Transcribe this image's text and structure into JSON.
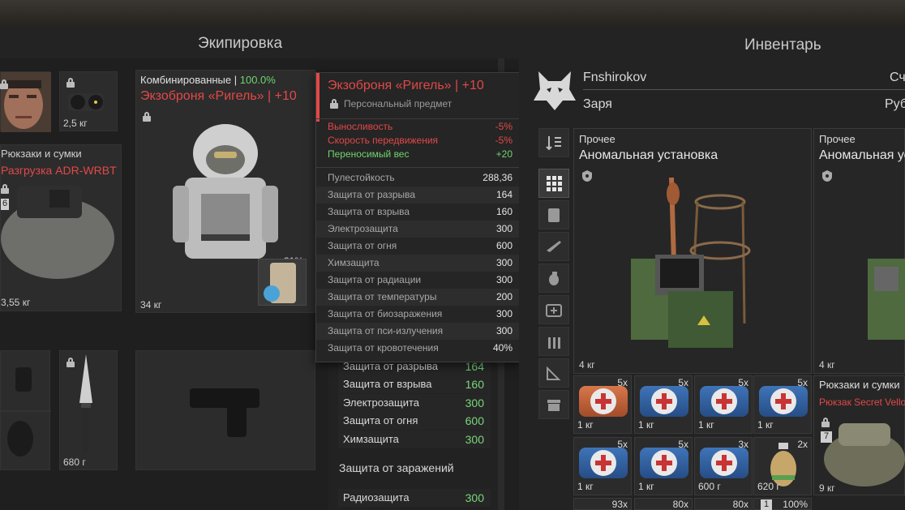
{
  "header": {
    "equipment_title": "Экипировка",
    "inventory_title": "Инвентарь"
  },
  "equipment": {
    "slot_helmet_weight": "2,5 кг",
    "backpack": {
      "category": "Рюкзаки и сумки",
      "name": "Разгрузка ADR-WRBT",
      "badge": "6",
      "weight": "3,55 кг"
    },
    "armor": {
      "category": "Комбинированные",
      "percent": "100.0%",
      "name": "Экзоброня «Ригель» | +10",
      "weight": "34 кг",
      "container_percent": "31%"
    },
    "knife_weight": "680 г"
  },
  "tooltip": {
    "title": "Экзоброня «Ригель» | +10",
    "subtitle": "Персональный предмет",
    "effects": [
      {
        "label": "Выносливость",
        "value": "-5%",
        "color": "#e24848"
      },
      {
        "label": "Скорость передвижения",
        "value": "-5%",
        "color": "#e24848"
      },
      {
        "label": "Переносимый вес",
        "value": "+20",
        "color": "#6fd46f"
      }
    ],
    "stats": [
      {
        "label": "Пулестойкость",
        "value": "288,36"
      },
      {
        "label": "Защита от разрыва",
        "value": "164"
      },
      {
        "label": "Защита от взрыва",
        "value": "160"
      },
      {
        "label": "Электрозащита",
        "value": "300"
      },
      {
        "label": "Защита от огня",
        "value": "600"
      },
      {
        "label": "Химзащита",
        "value": "300"
      },
      {
        "label": "Защита от радиации",
        "value": "300"
      },
      {
        "label": "Защита от температуры",
        "value": "200"
      },
      {
        "label": "Защита от биозаражения",
        "value": "300"
      },
      {
        "label": "Защита от пси-излучения",
        "value": "300"
      },
      {
        "label": "Защита от кровотечения",
        "value": "40%"
      }
    ]
  },
  "stats_panel": {
    "rows": [
      {
        "label": "Защита от разрыва",
        "value": "164"
      },
      {
        "label": "Защита от взрыва",
        "value": "160"
      },
      {
        "label": "Электрозащита",
        "value": "300"
      },
      {
        "label": "Защита от огня",
        "value": "600"
      },
      {
        "label": "Химзащита",
        "value": "300"
      }
    ],
    "section_title": "Защита от заражений",
    "rad_row": {
      "label": "Радиозащита",
      "value": "300"
    }
  },
  "player": {
    "name": "Fnshirokov",
    "faction": "Заря",
    "right_top": "Сч",
    "right_bottom": "Руб"
  },
  "inventory": {
    "card1": {
      "category": "Прочее",
      "name": "Аномальная установка",
      "weight": "4 кг"
    },
    "card2": {
      "category": "Прочее",
      "name": "Аномальная уст",
      "weight": "4 кг"
    },
    "card3": {
      "category": "Рюкзаки и сумки",
      "name": "Рюкзак Secret Vello",
      "badge": "7",
      "weight": "9 кг"
    },
    "cells": [
      {
        "count": "5x",
        "weight": "1 кг",
        "color": "orange"
      },
      {
        "count": "5x",
        "weight": "1 кг",
        "color": "blue"
      },
      {
        "count": "5x",
        "weight": "1 кг",
        "color": "blue"
      },
      {
        "count": "5x",
        "weight": "1 кг",
        "color": "blue"
      },
      {
        "count": "5x",
        "weight": "1 кг",
        "color": "blue"
      },
      {
        "count": "5x",
        "weight": "1 кг",
        "color": "blue"
      },
      {
        "count": "3x",
        "weight": "600 г",
        "color": "blue"
      },
      {
        "count": "2x",
        "weight": "620 г",
        "color": "grenade"
      }
    ],
    "bottom_counts": [
      "93x",
      "80x",
      "80x",
      "100%"
    ],
    "bottom_badge": "1"
  }
}
